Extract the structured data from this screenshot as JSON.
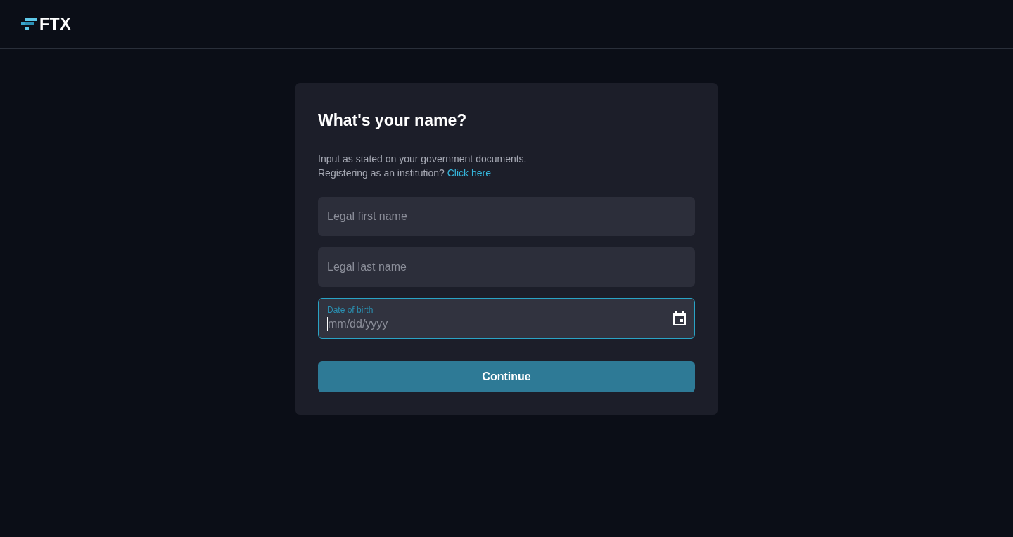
{
  "header": {
    "logo": {
      "text": "FTX"
    }
  },
  "form": {
    "title": "What's your name?",
    "description": "Input as stated on your government documents.",
    "institution_prompt": "Registering as an institution?",
    "institution_link": "Click here",
    "fields": [
      {
        "kind": "text",
        "placeholder": "Legal first name",
        "focused": false
      },
      {
        "kind": "text",
        "placeholder": "Legal last name",
        "focused": false
      },
      {
        "kind": "date",
        "label": "Date of birth",
        "placeholder": "mm/dd/yyyy",
        "focused": true
      }
    ],
    "submit": "Continue"
  }
}
